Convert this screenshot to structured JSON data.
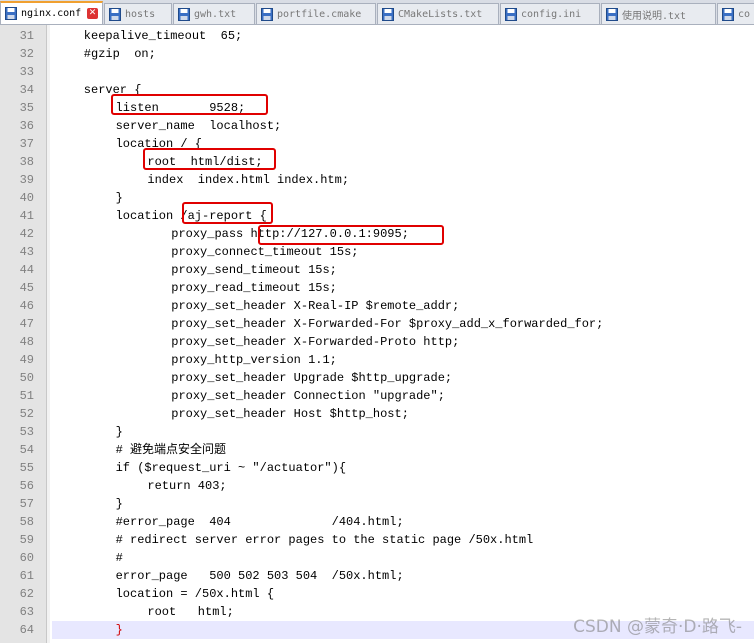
{
  "tabs": [
    {
      "label": "nginx.conf",
      "active": true,
      "icon": "save-file-icon"
    },
    {
      "label": "hosts",
      "active": false,
      "icon": "save-file-icon"
    },
    {
      "label": "gwh.txt",
      "active": false,
      "icon": "save-file-icon"
    },
    {
      "label": "portfile.cmake",
      "active": false,
      "icon": "save-file-icon"
    },
    {
      "label": "CMakeLists.txt",
      "active": false,
      "icon": "save-file-icon"
    },
    {
      "label": "config.ini",
      "active": false,
      "icon": "save-file-icon"
    },
    {
      "label": "使用说明.txt",
      "active": false,
      "icon": "save-file-icon"
    },
    {
      "label": "co",
      "active": false,
      "icon": "save-file-icon"
    }
  ],
  "editor": {
    "current_line": 64,
    "lines": [
      {
        "n": "31",
        "indent": 4,
        "text": "keepalive_timeout  65;"
      },
      {
        "n": "32",
        "indent": 4,
        "text": "#gzip  on;"
      },
      {
        "n": "33",
        "indent": 0,
        "text": ""
      },
      {
        "n": "34",
        "indent": 4,
        "text": "server {"
      },
      {
        "n": "35",
        "indent": 8,
        "text": "listen       9528;"
      },
      {
        "n": "36",
        "indent": 8,
        "text": "server_name  localhost;"
      },
      {
        "n": "37",
        "indent": 8,
        "text": "location / {"
      },
      {
        "n": "38",
        "indent": 12,
        "text": "root  html/dist;"
      },
      {
        "n": "39",
        "indent": 12,
        "text": "index  index.html index.htm;"
      },
      {
        "n": "40",
        "indent": 8,
        "text": "}"
      },
      {
        "n": "41",
        "indent": 8,
        "text": "location /aj-report {"
      },
      {
        "n": "42",
        "indent": 15,
        "text": "proxy_pass http://127.0.0.1:9095;"
      },
      {
        "n": "43",
        "indent": 15,
        "text": "proxy_connect_timeout 15s;"
      },
      {
        "n": "44",
        "indent": 15,
        "text": "proxy_send_timeout 15s;"
      },
      {
        "n": "45",
        "indent": 15,
        "text": "proxy_read_timeout 15s;"
      },
      {
        "n": "46",
        "indent": 15,
        "text": "proxy_set_header X-Real-IP $remote_addr;"
      },
      {
        "n": "47",
        "indent": 15,
        "text": "proxy_set_header X-Forwarded-For $proxy_add_x_forwarded_for;"
      },
      {
        "n": "48",
        "indent": 15,
        "text": "proxy_set_header X-Forwarded-Proto http;"
      },
      {
        "n": "49",
        "indent": 15,
        "text": "proxy_http_version 1.1;"
      },
      {
        "n": "50",
        "indent": 15,
        "text": "proxy_set_header Upgrade $http_upgrade;"
      },
      {
        "n": "51",
        "indent": 15,
        "text": "proxy_set_header Connection \"upgrade\";"
      },
      {
        "n": "52",
        "indent": 15,
        "text": "proxy_set_header Host $http_host;"
      },
      {
        "n": "53",
        "indent": 8,
        "text": "}"
      },
      {
        "n": "54",
        "indent": 8,
        "text": "# 避免端点安全问题"
      },
      {
        "n": "55",
        "indent": 8,
        "text": "if ($request_uri ~ \"/actuator\"){"
      },
      {
        "n": "56",
        "indent": 12,
        "text": "return 403;"
      },
      {
        "n": "57",
        "indent": 8,
        "text": "}"
      },
      {
        "n": "58",
        "indent": 8,
        "text": "#error_page  404              /404.html;"
      },
      {
        "n": "59",
        "indent": 8,
        "text": "# redirect server error pages to the static page /50x.html"
      },
      {
        "n": "60",
        "indent": 8,
        "text": "#"
      },
      {
        "n": "61",
        "indent": 8,
        "text": "error_page   500 502 503 504  /50x.html;"
      },
      {
        "n": "62",
        "indent": 8,
        "text": "location = /50x.html {"
      },
      {
        "n": "63",
        "indent": 12,
        "text": "root   html;"
      },
      {
        "n": "64",
        "indent": 8,
        "text": "}"
      }
    ]
  },
  "highlight_color": "#e00000",
  "current_line_color": "#e8e8ff",
  "watermark": "CSDN @蒙奇·D·路飞-"
}
